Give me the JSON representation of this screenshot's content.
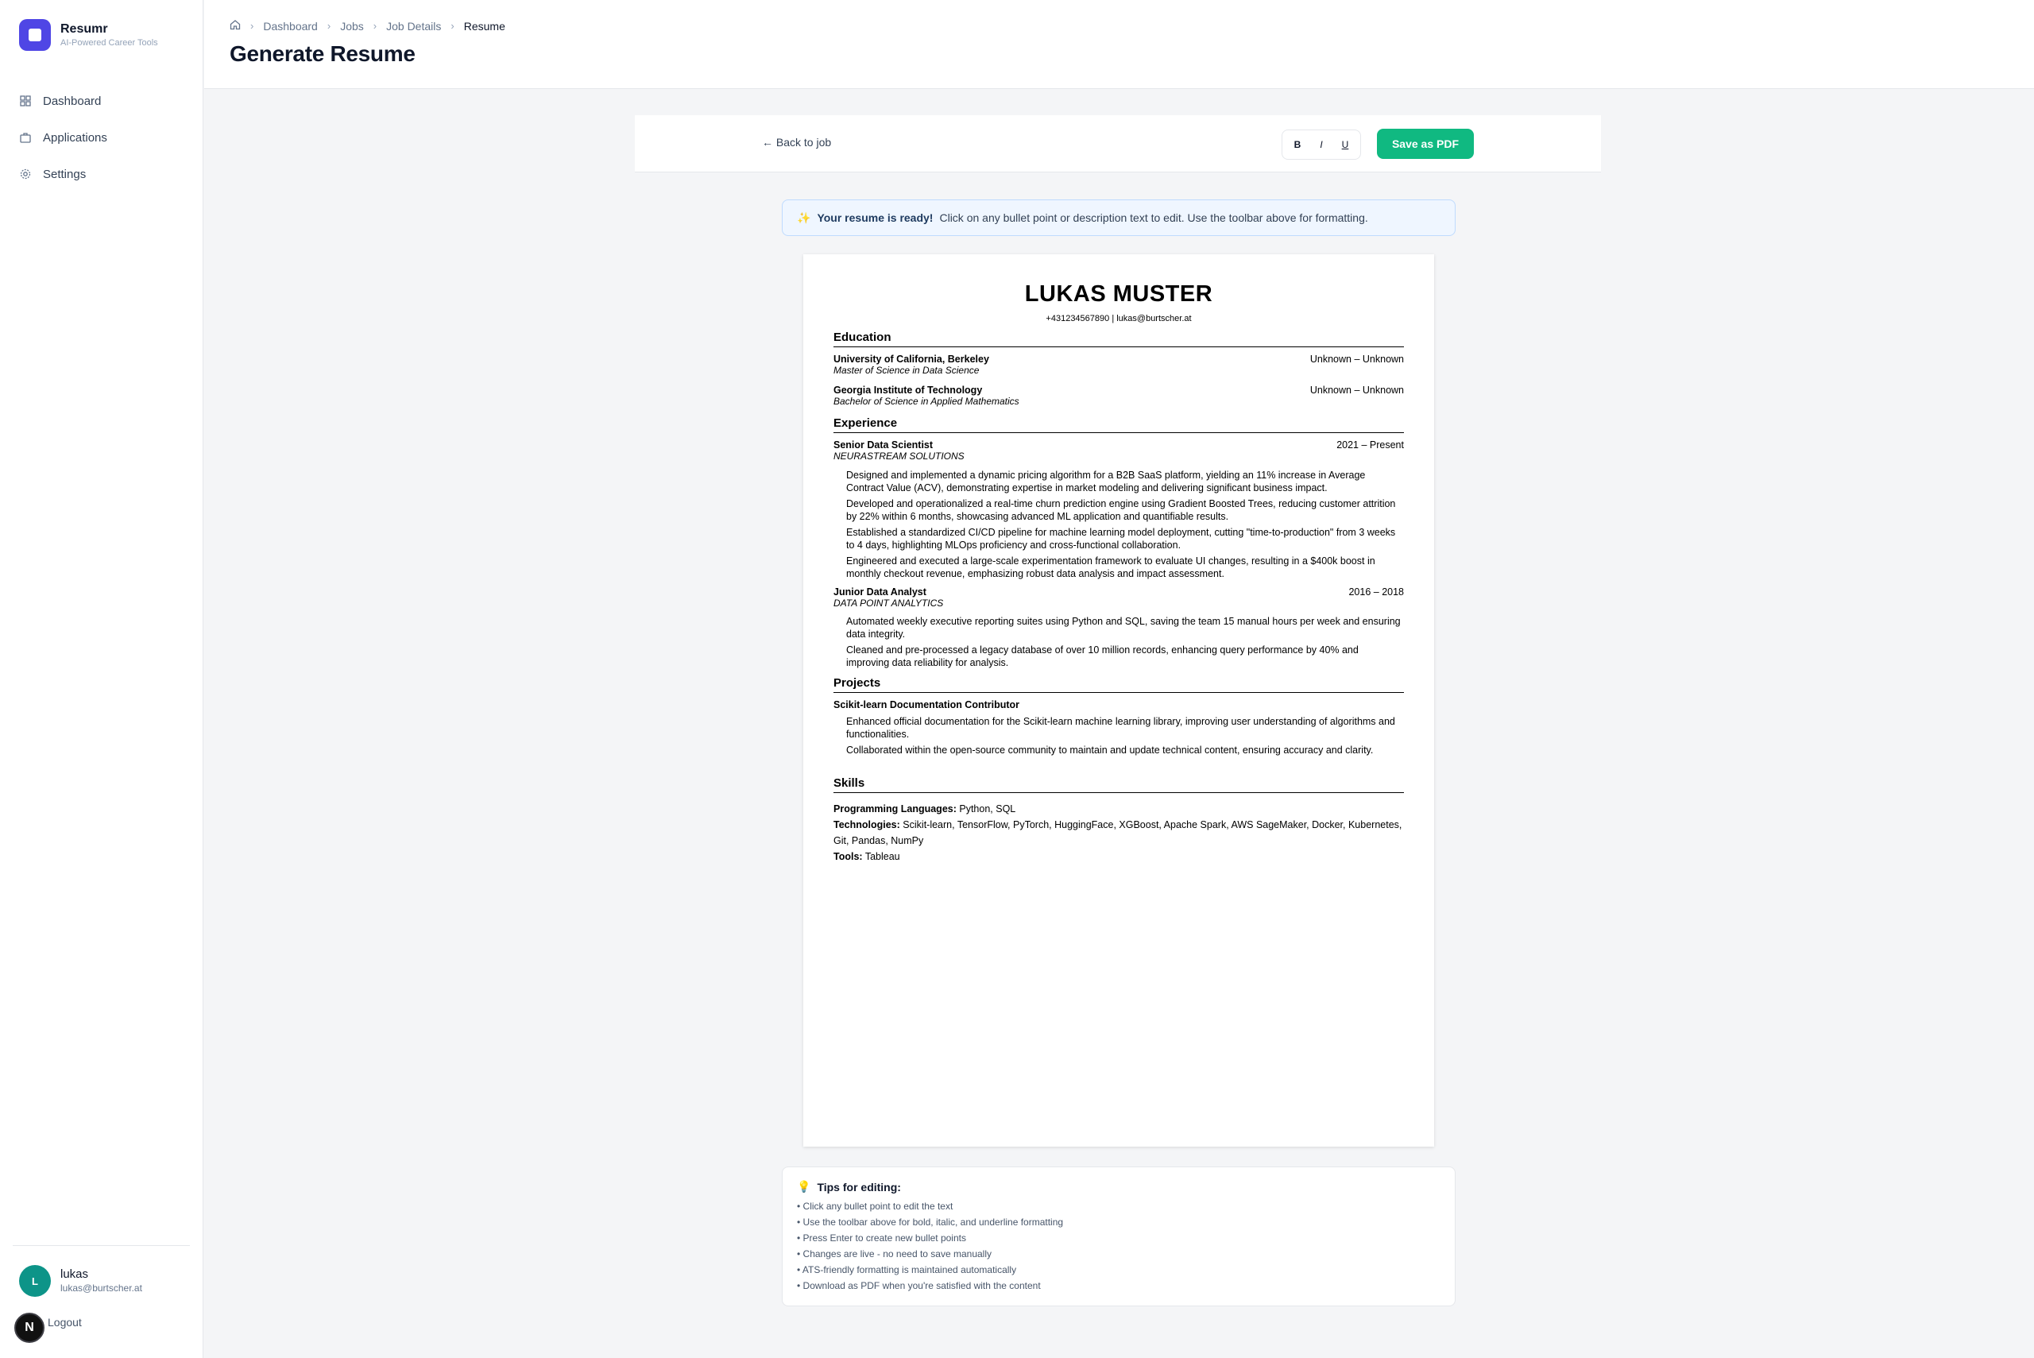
{
  "brand": {
    "name": "Resumr",
    "tagline": "AI-Powered Career Tools"
  },
  "nav": [
    {
      "label": "Dashboard",
      "icon": "grid-icon"
    },
    {
      "label": "Applications",
      "icon": "briefcase-icon"
    },
    {
      "label": "Settings",
      "icon": "gear-icon"
    }
  ],
  "user": {
    "initial": "L",
    "name": "lukas",
    "email": "lukas@burtscher.at",
    "logout": "Logout",
    "badge": "N"
  },
  "breadcrumb": [
    "Dashboard",
    "Jobs",
    "Job Details",
    "Resume"
  ],
  "page_title": "Generate Resume",
  "toolbar": {
    "back": "← Back to job",
    "bold": "B",
    "italic": "I",
    "underline": "U",
    "save": "Save as PDF"
  },
  "notice": {
    "emoji": "✨",
    "strong": "Your resume is ready!",
    "text": "Click on any bullet point or description text to edit. Use the toolbar above for formatting."
  },
  "resume": {
    "name": "LUKAS MUSTER",
    "contact": "+431234567890 | lukas@burtscher.at",
    "sections": {
      "education": "Education",
      "experience": "Experience",
      "projects": "Projects",
      "skills": "Skills"
    },
    "education": [
      {
        "school": "University of California, Berkeley",
        "degree": "Master of Science in Data Science",
        "dates": "Unknown – Unknown"
      },
      {
        "school": "Georgia Institute of Technology",
        "degree": "Bachelor of Science in Applied Mathematics",
        "dates": "Unknown – Unknown"
      }
    ],
    "experience": [
      {
        "title": "Senior Data Scientist",
        "company": "NEURASTREAM SOLUTIONS",
        "dates": "2021 – Present",
        "bullets": [
          "Designed and implemented a dynamic pricing algorithm for a B2B SaaS platform, yielding an 11% increase in Average Contract Value (ACV), demonstrating expertise in market modeling and delivering significant business impact.",
          "Developed and operationalized a real-time churn prediction engine using Gradient Boosted Trees, reducing customer attrition by 22% within 6 months, showcasing advanced ML application and quantifiable results.",
          "Established a standardized CI/CD pipeline for machine learning model deployment, cutting \"time-to-production\" from 3 weeks to 4 days, highlighting MLOps proficiency and cross-functional collaboration.",
          "Engineered and executed a large-scale experimentation framework to evaluate UI changes, resulting in a $400k boost in monthly checkout revenue, emphasizing robust data analysis and impact assessment."
        ]
      },
      {
        "title": "Junior Data Analyst",
        "company": "DATA POINT ANALYTICS",
        "dates": "2016 – 2018",
        "bullets": [
          "Automated weekly executive reporting suites using Python and SQL, saving the team 15 manual hours per week and ensuring data integrity.",
          "Cleaned and pre-processed a legacy database of over 10 million records, enhancing query performance by 40% and improving data reliability for analysis."
        ]
      }
    ],
    "projects": [
      {
        "title": "Scikit-learn Documentation Contributor",
        "bullets": [
          "Enhanced official documentation for the Scikit-learn machine learning library, improving user understanding of algorithms and functionalities.",
          "Collaborated within the open-source community to maintain and update technical content, ensuring accuracy and clarity."
        ]
      }
    ],
    "skills": [
      {
        "label": "Programming Languages:",
        "value": "Python, SQL"
      },
      {
        "label": "Technologies:",
        "value": "Scikit-learn, TensorFlow, PyTorch, HuggingFace, XGBoost, Apache Spark, AWS SageMaker, Docker, Kubernetes, Git, Pandas, NumPy"
      },
      {
        "label": "Tools:",
        "value": "Tableau"
      }
    ]
  },
  "tips": {
    "emoji": "💡",
    "title": "Tips for editing:",
    "items": [
      "• Click any bullet point to edit the text",
      "• Use the toolbar above for bold, italic, and underline formatting",
      "• Press Enter to create new bullet points",
      "• Changes are live - no need to save manually",
      "• ATS-friendly formatting is maintained automatically",
      "• Download as PDF when you're satisfied with the content"
    ]
  },
  "colors": {
    "brand": "#4f46e5",
    "save": "#10b981",
    "avatar": "#0d9488"
  }
}
